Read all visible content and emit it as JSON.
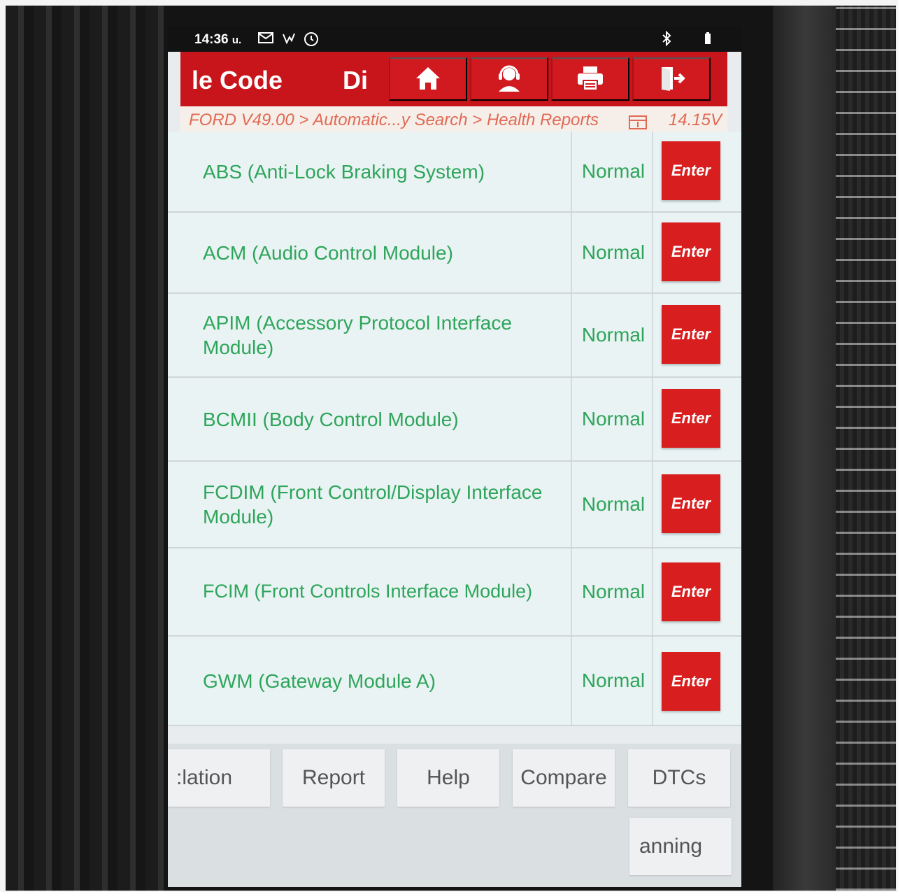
{
  "status_bar": {
    "time": "14:36",
    "carrier": "u.",
    "icons": [
      "mail-icon",
      "signal-wave-icon",
      "clock-badge-icon",
      "bluetooth-icon",
      "battery-icon"
    ]
  },
  "toolbar": {
    "title_left": "le Code",
    "title_right": "Di",
    "buttons": [
      {
        "icon": "home-icon"
      },
      {
        "icon": "support-agent-icon"
      },
      {
        "icon": "print-icon"
      },
      {
        "icon": "exit-icon"
      }
    ]
  },
  "breadcrumb": {
    "path": "FORD V49.00 > Automatic...y Search > Health Reports",
    "voltage": "14.15V"
  },
  "modules": [
    {
      "name": "ABS (Anti-Lock Braking System)",
      "status": "Normal",
      "action": "Enter"
    },
    {
      "name": "ACM (Audio Control Module)",
      "status": "Normal",
      "action": "Enter"
    },
    {
      "name": "APIM (Accessory Protocol Interface Module)",
      "status": "Normal",
      "action": "Enter"
    },
    {
      "name": "BCMII (Body Control Module)",
      "status": "Normal",
      "action": "Enter"
    },
    {
      "name": "FCDIM (Front Control/Display Interface Module)",
      "status": "Normal",
      "action": "Enter"
    },
    {
      "name": "FCIM (Front Controls Interface Module)",
      "status": "Normal",
      "action": "Enter"
    },
    {
      "name": "GWM (Gateway Module A)",
      "status": "Normal",
      "action": "Enter"
    }
  ],
  "bottom_buttons": {
    "b1": ":lation",
    "b2": "Report",
    "b3": "Help",
    "b4": "Compare",
    "b5": "DTCs",
    "b6": "anning"
  },
  "colors": {
    "brand_red": "#c8141b",
    "status_green": "#2ea55a",
    "breadcrumb_text": "#e06a55"
  }
}
